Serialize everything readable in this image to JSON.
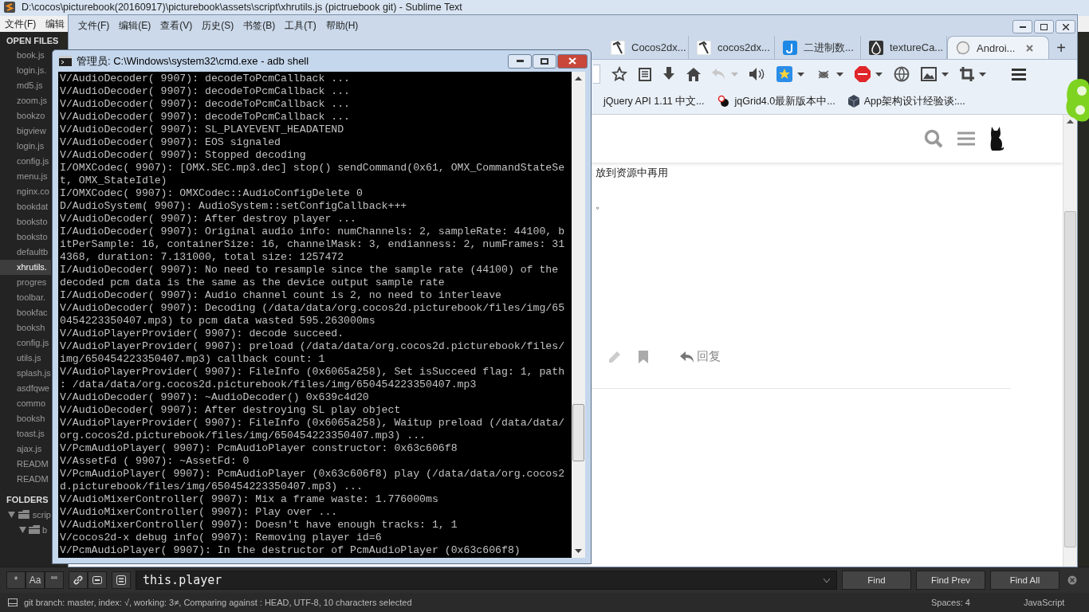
{
  "editor": {
    "title": "D:\\cocos\\picturebook(20160917)\\picturebook\\assets\\script\\xhrutils.js (pictruebook git) - Sublime Text",
    "menu": [
      "文件(F)",
      "编辑"
    ],
    "sidebar": {
      "open_files_heading": "OPEN FILES",
      "files": [
        {
          "name": "book.js",
          "selected": false
        },
        {
          "name": "login.js.",
          "selected": false
        },
        {
          "name": "md5.js",
          "selected": false
        },
        {
          "name": "zoom.js",
          "selected": false
        },
        {
          "name": "bookzo",
          "selected": false
        },
        {
          "name": "bigview",
          "selected": false
        },
        {
          "name": "login.js",
          "selected": false
        },
        {
          "name": "config.js",
          "selected": false
        },
        {
          "name": "menu.js",
          "selected": false
        },
        {
          "name": "nginx.co",
          "selected": false
        },
        {
          "name": "bookdat",
          "selected": false
        },
        {
          "name": "booksto",
          "selected": false
        },
        {
          "name": "booksto",
          "selected": false
        },
        {
          "name": "defaultb",
          "selected": false
        },
        {
          "name": "xhrutils.",
          "selected": true
        },
        {
          "name": "progres",
          "selected": false
        },
        {
          "name": "toolbar.",
          "selected": false
        },
        {
          "name": "bookfac",
          "selected": false
        },
        {
          "name": "booksh",
          "selected": false
        },
        {
          "name": "config.js",
          "selected": false
        },
        {
          "name": "utils.js",
          "selected": false
        },
        {
          "name": "splash.js",
          "selected": false
        },
        {
          "name": "asdfqwe",
          "selected": false
        },
        {
          "name": "commo",
          "selected": false
        },
        {
          "name": "booksh",
          "selected": false
        },
        {
          "name": "toast.js",
          "selected": false
        },
        {
          "name": "ajax.js",
          "selected": false
        },
        {
          "name": "READM",
          "selected": false
        },
        {
          "name": "READM",
          "selected": false
        }
      ],
      "folders_heading": "FOLDERS",
      "folders": [
        {
          "name": "scrip",
          "expanded": true,
          "children": [
            {
              "name": "b",
              "expanded": true
            }
          ]
        }
      ]
    },
    "find_bar": {
      "options": [
        "*",
        "Aa",
        "““"
      ],
      "query": "this.player",
      "buttons": [
        "Find",
        "Find Prev",
        "Find All"
      ]
    },
    "status_bar": {
      "info": "git branch: master, index: √, working: 3≠, Comparing against : HEAD, UTF-8, 10 characters selected",
      "indent": "Spaces: 4",
      "syntax": "JavaScript"
    }
  },
  "browser": {
    "menu": [
      "文件(F)",
      "编辑(E)",
      "查看(V)",
      "历史(S)",
      "书签(B)",
      "工具(T)",
      "帮助(H)"
    ],
    "tabs": [
      {
        "label": "Cocos2dx...",
        "kind": "hammer",
        "selected": false
      },
      {
        "label": "cocos2dx...",
        "kind": "hammer",
        "selected": false
      },
      {
        "label": "二进制数...",
        "kind": "letter",
        "selected": false
      },
      {
        "label": "textureCa...",
        "kind": "drop",
        "selected": false
      },
      {
        "label": "Androi...",
        "kind": "bubble",
        "selected": true
      }
    ],
    "new_tab": "+",
    "bookmarks": [
      {
        "label": "jQuery API 1.11 中文...",
        "kind": "plain"
      },
      {
        "label": "jqGrid4.0最新版本中...",
        "kind": "bird"
      },
      {
        "label": "App架构设计经验谈:...",
        "kind": "cube"
      }
    ],
    "page": {
      "lines": [
        "放到资源中再用",
        "。"
      ],
      "reply": "回复"
    }
  },
  "terminal": {
    "title": "管理员: C:\\Windows\\system32\\cmd.exe - adb  shell",
    "lines": [
      "V/AudioDecoder( 9907): decodeToPcmCallback ...",
      "V/AudioDecoder( 9907): decodeToPcmCallback ...",
      "V/AudioDecoder( 9907): decodeToPcmCallback ...",
      "V/AudioDecoder( 9907): decodeToPcmCallback ...",
      "V/AudioDecoder( 9907): SL_PLAYEVENT_HEADATEND",
      "V/AudioDecoder( 9907): EOS signaled",
      "V/AudioDecoder( 9907): Stopped decoding",
      "I/OMXCodec( 9907): [OMX.SEC.mp3.dec] stop() sendCommand(0x61, OMX_CommandStateSe",
      "t, OMX_StateIdle)",
      "I/OMXCodec( 9907): OMXCodec::AudioConfigDelete 0",
      "D/AudioSystem( 9907): AudioSystem::setConfigCallback+++",
      "V/AudioDecoder( 9907): After destroy player ...",
      "I/AudioDecoder( 9907): Original audio info: numChannels: 2, sampleRate: 44100, b",
      "itPerSample: 16, containerSize: 16, channelMask: 3, endianness: 2, numFrames: 31",
      "4368, duration: 7.131000, total size: 1257472",
      "I/AudioDecoder( 9907): No need to resample since the sample rate (44100) of the",
      "decoded pcm data is the same as the device output sample rate",
      "I/AudioDecoder( 9907): Audio channel count is 2, no need to interleave",
      "V/AudioDecoder( 9907): Decoding (/data/data/org.cocos2d.picturebook/files/img/65",
      "0454223350407.mp3) to pcm data wasted 595.263000ms",
      "V/AudioPlayerProvider( 9907): decode succeed.",
      "V/AudioPlayerProvider( 9907): preload (/data/data/org.cocos2d.picturebook/files/",
      "img/650454223350407.mp3) callback count: 1",
      "V/AudioPlayerProvider( 9907): FileInfo (0x6065a258), Set isSucceed flag: 1, path",
      ": /data/data/org.cocos2d.picturebook/files/img/650454223350407.mp3",
      "V/AudioDecoder( 9907): ~AudioDecoder() 0x639c4d20",
      "V/AudioDecoder( 9907): After destroying SL play object",
      "V/AudioPlayerProvider( 9907): FileInfo (0x6065a258), Waitup preload (/data/data/",
      "org.cocos2d.picturebook/files/img/650454223350407.mp3) ...",
      "V/PcmAudioPlayer( 9907): PcmAudioPlayer constructor: 0x63c606f8",
      "V/AssetFd ( 9907): ~AssetFd: 0",
      "V/PcmAudioPlayer( 9907): PcmAudioPlayer (0x63c606f8) play (/data/data/org.cocos2",
      "d.picturebook/files/img/650454223350407.mp3) ...",
      "V/AudioMixerController( 9907): Mix a frame waste: 1.776000ms",
      "V/AudioMixerController( 9907): Play over ...",
      "V/AudioMixerController( 9907): Doesn't have enough tracks: 1, 1",
      "V/cocos2d-x debug info( 9907): Removing player id=6",
      "V/PcmAudioPlayer( 9907): In the destructor of PcmAudioPlayer (0x63c606f8)"
    ]
  }
}
